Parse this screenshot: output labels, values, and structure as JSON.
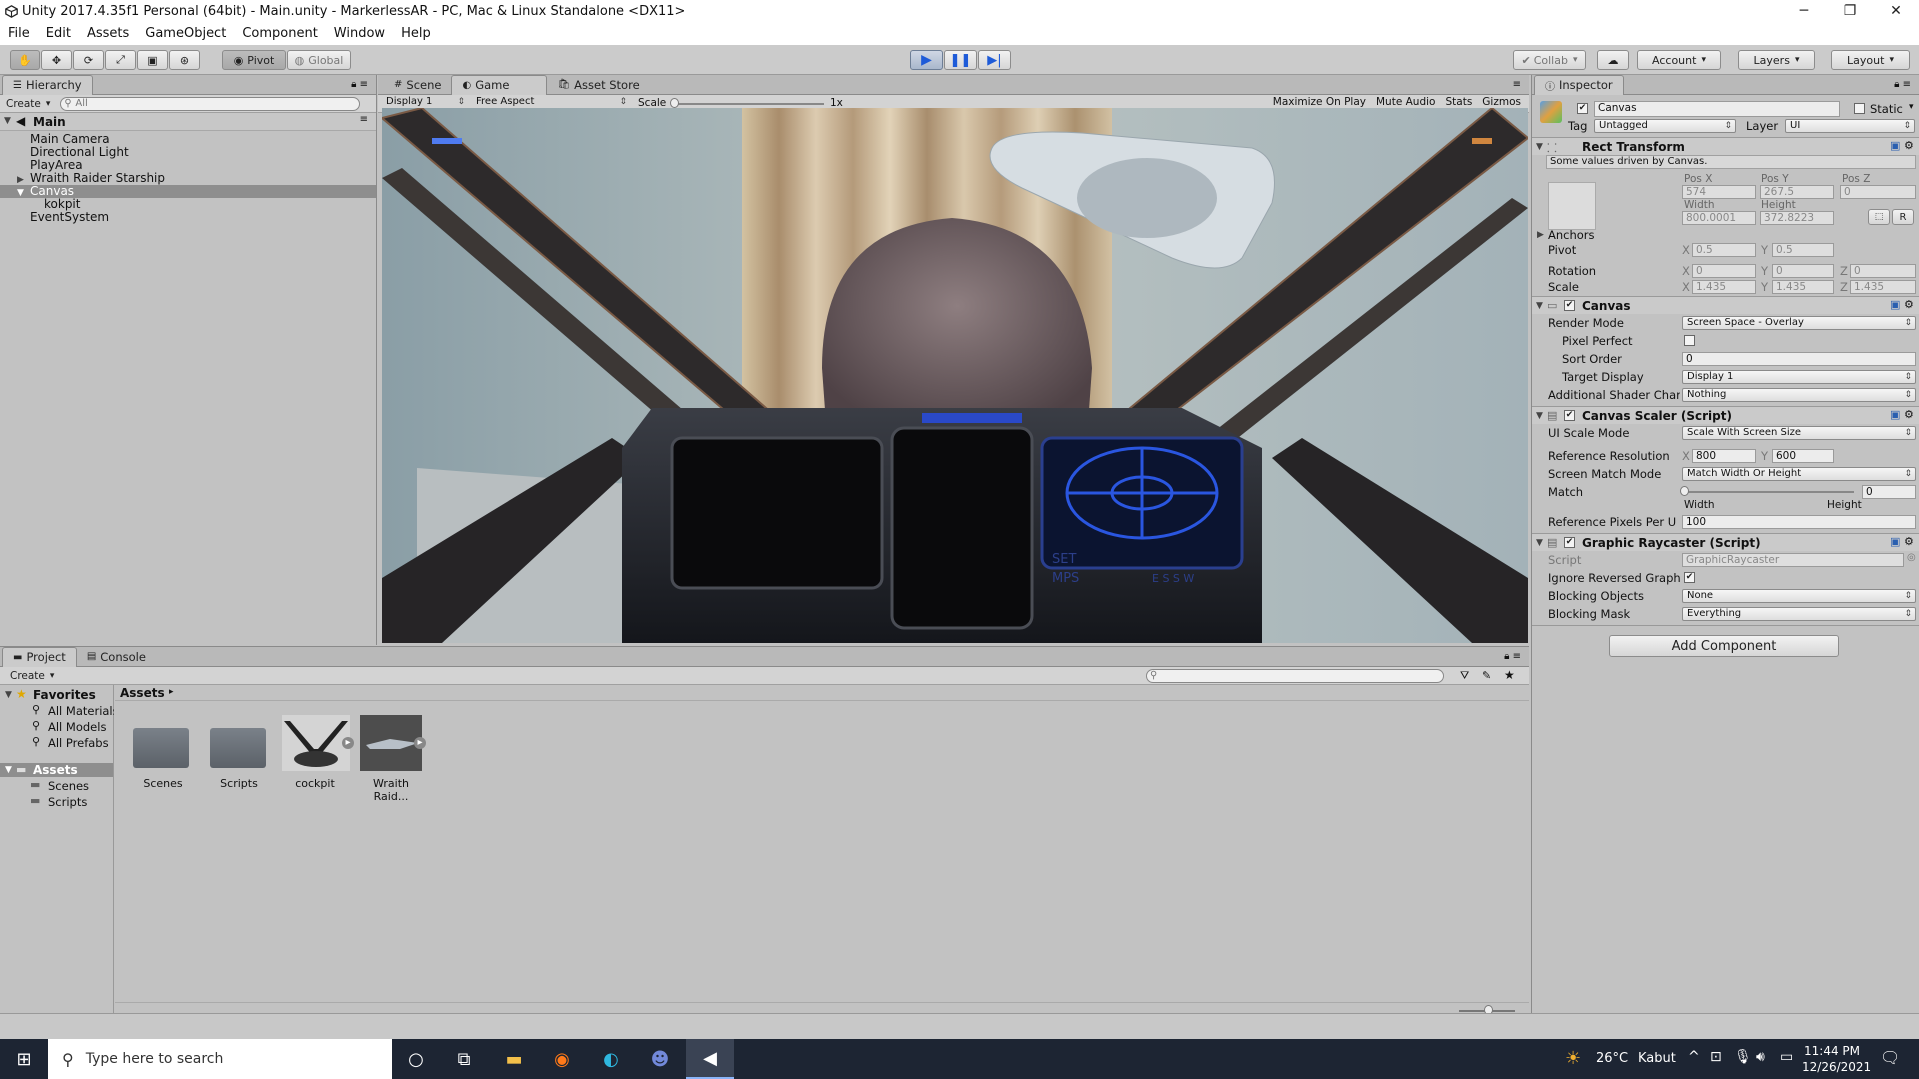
{
  "window": {
    "title": "Unity 2017.4.35f1 Personal (64bit) - Main.unity - MarkerlessAR - PC, Mac & Linux Standalone <DX11>",
    "minimize": "─",
    "maximize": "❐",
    "close": "✕"
  },
  "menu": [
    "File",
    "Edit",
    "Assets",
    "GameObject",
    "Component",
    "Window",
    "Help"
  ],
  "toolbar": {
    "pivot": "Pivot",
    "global": "Global",
    "collab": "Collab",
    "account": "Account",
    "layers": "Layers",
    "layout": "Layout"
  },
  "hierarchy": {
    "tab": "Hierarchy",
    "create": "Create",
    "search_placeholder": "All",
    "scene": "Main",
    "items": [
      {
        "label": "Main Camera"
      },
      {
        "label": "Directional Light"
      },
      {
        "label": "PlayArea"
      },
      {
        "label": "Wraith Raider Starship"
      },
      {
        "label": "Canvas"
      },
      {
        "label": "kokpit"
      },
      {
        "label": "EventSystem"
      }
    ]
  },
  "center": {
    "tabs": [
      "Scene",
      "Game",
      "Asset Store"
    ],
    "display": "Display 1",
    "aspect": "Free Aspect",
    "scale_label": "Scale",
    "scale_value": "1x",
    "toggles": [
      "Maximize On Play",
      "Mute Audio",
      "Stats",
      "Gizmos"
    ],
    "hud": {
      "set": "SET",
      "mps": "MPS",
      "row": "E  S  S  W"
    }
  },
  "project": {
    "tabs": [
      "Project",
      "Console"
    ],
    "create": "Create",
    "favorites": {
      "title": "Favorites",
      "items": [
        "All Materials",
        "All Models",
        "All Prefabs"
      ]
    },
    "assets_tree": {
      "title": "Assets",
      "items": [
        "Scenes",
        "Scripts"
      ]
    },
    "breadcrumb": "Assets",
    "grid": [
      {
        "label": "Scenes"
      },
      {
        "label": "Scripts"
      },
      {
        "label": "cockpit"
      },
      {
        "label": "Wraith Raid..."
      }
    ]
  },
  "inspector": {
    "tab": "Inspector",
    "name": "Canvas",
    "static": "Static",
    "tag_label": "Tag",
    "tag": "Untagged",
    "layer_label": "Layer",
    "layer": "UI",
    "rect": {
      "title": "Rect Transform",
      "note": "Some values driven by Canvas.",
      "posx_l": "Pos X",
      "posy_l": "Pos Y",
      "posz_l": "Pos Z",
      "posx": "574",
      "posy": "267.5",
      "posz": "0",
      "width_l": "Width",
      "height_l": "Height",
      "width": "800.0001",
      "height": "372.8223",
      "r_btn": "R",
      "anchors": "Anchors",
      "pivot": "Pivot",
      "pivot_x": "0.5",
      "pivot_y": "0.5",
      "rotation": "Rotation",
      "rot_x": "0",
      "rot_y": "0",
      "rot_z": "0",
      "scale": "Scale",
      "sc_x": "1.435",
      "sc_y": "1.435",
      "sc_z": "1.435",
      "x": "X",
      "y": "Y",
      "z": "Z"
    },
    "canvas": {
      "title": "Canvas",
      "render_mode_l": "Render Mode",
      "render_mode": "Screen Space - Overlay",
      "pixel_perfect_l": "Pixel Perfect",
      "sort_order_l": "Sort Order",
      "sort_order": "0",
      "target_display_l": "Target Display",
      "target_display": "Display 1",
      "shader_l": "Additional Shader Char",
      "shader": "Nothing"
    },
    "scaler": {
      "title": "Canvas Scaler (Script)",
      "ui_scale_l": "UI Scale Mode",
      "ui_scale": "Scale With Screen Size",
      "ref_res_l": "Reference Resolution",
      "ref_x": "800",
      "ref_y": "600",
      "match_mode_l": "Screen Match Mode",
      "match_mode": "Match Width Or Height",
      "match_l": "Match",
      "match_val": "0",
      "match": 0,
      "width": "Width",
      "height": "Height",
      "ppu_l": "Reference Pixels Per U",
      "ppu": "100"
    },
    "raycaster": {
      "title": "Graphic Raycaster (Script)",
      "script_l": "Script",
      "script": "GraphicRaycaster",
      "ignore_l": "Ignore Reversed Graph",
      "blocking_l": "Blocking Objects",
      "blocking": "None",
      "mask_l": "Blocking Mask",
      "mask": "Everything"
    },
    "add_component": "Add Component"
  },
  "taskbar": {
    "search": "Type here to search",
    "temp": "26°C",
    "weather": "Kabut",
    "time": "11:44 PM",
    "date": "12/26/2021"
  }
}
